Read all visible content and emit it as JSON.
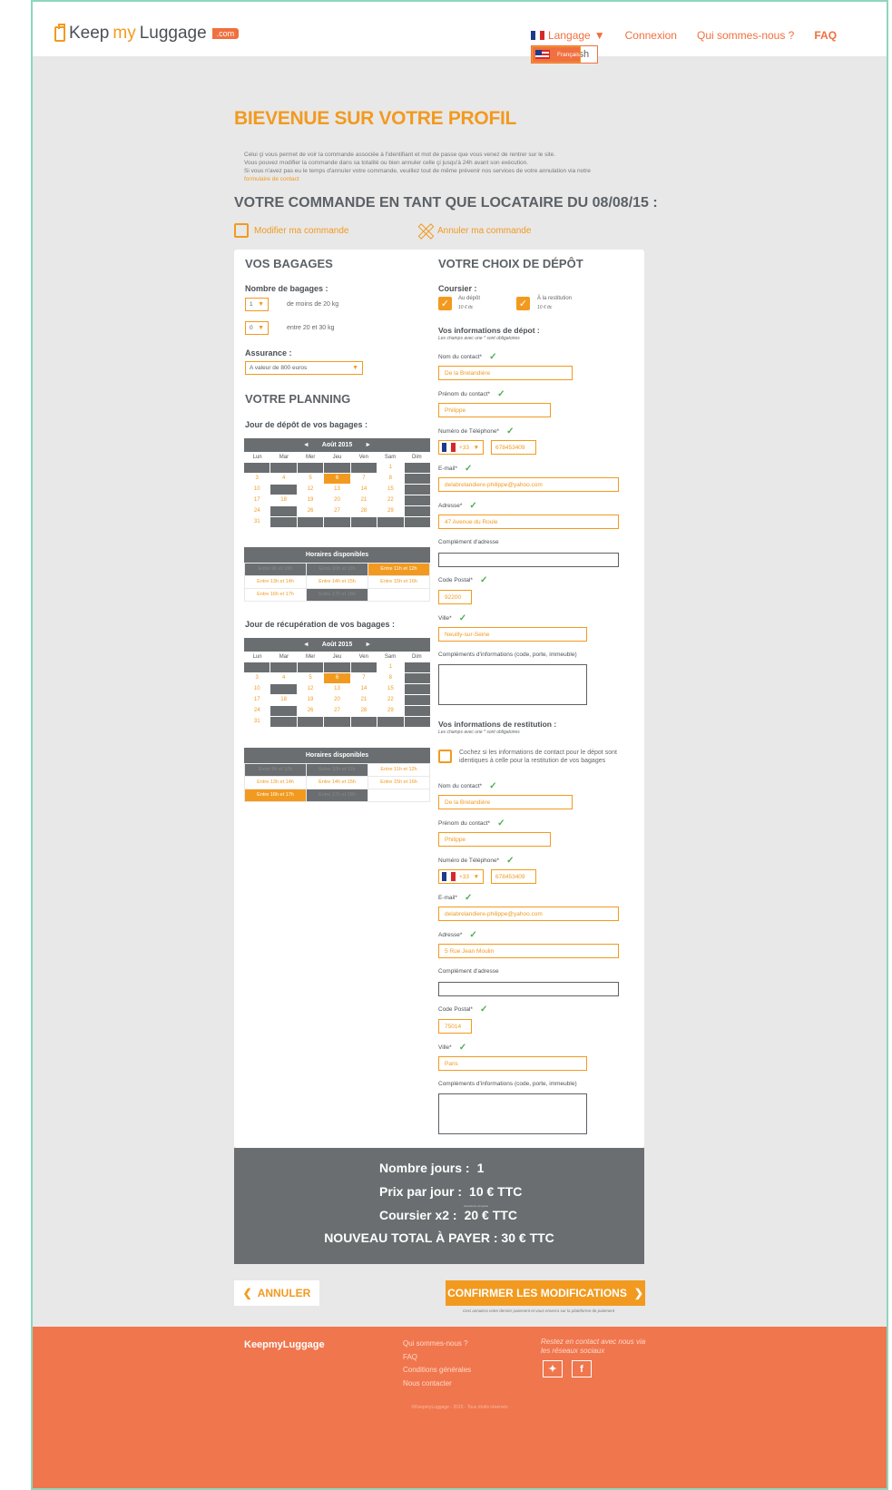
{
  "header": {
    "logo": {
      "keep": "Keep",
      "my": "my",
      "luggage": "Luggage",
      "com": ".com"
    },
    "nav": {
      "language": "Langage",
      "login": "Connexion",
      "about": "Qui sommes-nous ?",
      "faq": "FAQ"
    },
    "language_options": [
      "Français",
      "English"
    ]
  },
  "page": {
    "title": "BIEVENUE SUR VOTRE PROFIL",
    "intro": [
      "Celui çi vous permet de voir la commande associée à l'identifiant et mot de passe que vous venez de rentrer sur le site.",
      "Vous pouvez modifier la commande dans sa totalité ou bien annuler celle çi jusqu'à 24h avant son exécution.",
      "Si vous n'avez pas eu le temps d'annuler votre commande, veuillez tout de même prévenir nos services de votre annulation via notre"
    ],
    "intro_link": "formulaire de contact",
    "order_title": "VOTRE COMMANDE EN TANT QUE LOCATAIRE DU 08/08/15 :",
    "modify": "Modifier ma commande",
    "cancel_order": "Annuler ma commande"
  },
  "bagages": {
    "title": "VOS BAGAGES",
    "count_label": "Nombre de bagages :",
    "rows": [
      {
        "value": "1",
        "desc": "de moins de 20 kg"
      },
      {
        "value": "0",
        "desc": "entre 20 et 30 kg"
      }
    ],
    "insurance_label": "Assurance :",
    "insurance_value": "A valeur de 800 euros"
  },
  "planning": {
    "title": "VOTRE PLANNING",
    "deposit_label": "Jour de dépôt de vos bagages :",
    "pickup_label": "Jour de récupération de vos bagages :",
    "month": "Août 2015",
    "dows": [
      "Lun",
      "Mar",
      "Mer",
      "Jeu",
      "Ven",
      "Sam",
      "Dim"
    ],
    "hours_title": "Horaires disponibles",
    "hours": [
      "Entre 9h et 10h",
      "Entre 10h et 11h",
      "Entre 11h et 12h",
      "Entre 13h et 14h",
      "Entre 14h et 15h",
      "Entre 15h et 16h",
      "Entre 16h et 17h",
      "Entre 17h et 18h",
      ""
    ]
  },
  "depot": {
    "title": "VOTRE CHOIX DE DÉPÔT",
    "courier_label": "Coursier :",
    "courier_options": [
      {
        "label": "Au dépôt",
        "price": "10 € ttc"
      },
      {
        "label": "À la restitution",
        "price": "10 € ttc"
      }
    ],
    "info_title": "Vos informations de dépot :",
    "required_note": "Les champs avec une * sont obligatoires",
    "fields": {
      "contact_name_label": "Nom du contact*",
      "contact_name": "De la Brelandière",
      "contact_first_label": "Prénom du contact*",
      "contact_first": "Philippe",
      "phone_label": "Numéro de Téléphone*",
      "phone_cc": "+33",
      "phone": "678453409",
      "email_label": "E-mail*",
      "email": "delabrelandiere-philippe@yahoo.com",
      "address_label": "Adresse*",
      "address": "47 Avenue du Roule",
      "address2_label": "Complément d'adresse",
      "zip_label": "Code Postal*",
      "zip": "92200",
      "city_label": "Ville*",
      "city": "Neuilly-sur-Seine",
      "extra_label": "Compléments d'informations (code, porte, immeuble)"
    }
  },
  "restitution": {
    "title": "Vos informations de restitution :",
    "required_note": "Les champs avec une * sont obligatoires",
    "same_label": "Cochez si les informations de contact pour le dépot sont identiques à celle pour la restitution de vos bagages",
    "fields": {
      "contact_name": "De la Brelandière",
      "contact_first": "Philippe",
      "phone_cc": "+33",
      "phone": "678453409",
      "email": "delabrelandiere-philippe@yahoo.com",
      "address": "5 Rue Jean Moulin",
      "zip": "75014",
      "city": "Paris"
    }
  },
  "summary": {
    "days_label": "Nombre jours :",
    "days": "1",
    "price_label": "Prix par jour :",
    "price": "10 € TTC",
    "price_note": "Assurance comprise",
    "courier_label": "Coursier x2 :",
    "courier": "20 € TTC",
    "total": "NOUVEAU TOTAL À PAYER : 30 € TTC"
  },
  "buttons": {
    "cancel": "ANNULER",
    "confirm": "CONFIRMER LES MODIFICATIONS",
    "confirm_note": "Ceci annulera votre dernier paiement et vous enverra sur la plateforme de paiement"
  },
  "footer": {
    "brand": "KeepmyLuggage",
    "links": [
      "Qui sommes-nous ?",
      "FAQ",
      "Conditions générales",
      "Nous contacter"
    ],
    "social_text": "Restez en contact avec nous via les réseaux sociaux",
    "copyright": "©KeepmyLuggage - 2015 - Tous droits réservés"
  },
  "colors": {
    "accent": "#f29a1f",
    "nav": "#f0703f",
    "footer": "#f0764e",
    "dark": "#6a6e70"
  }
}
